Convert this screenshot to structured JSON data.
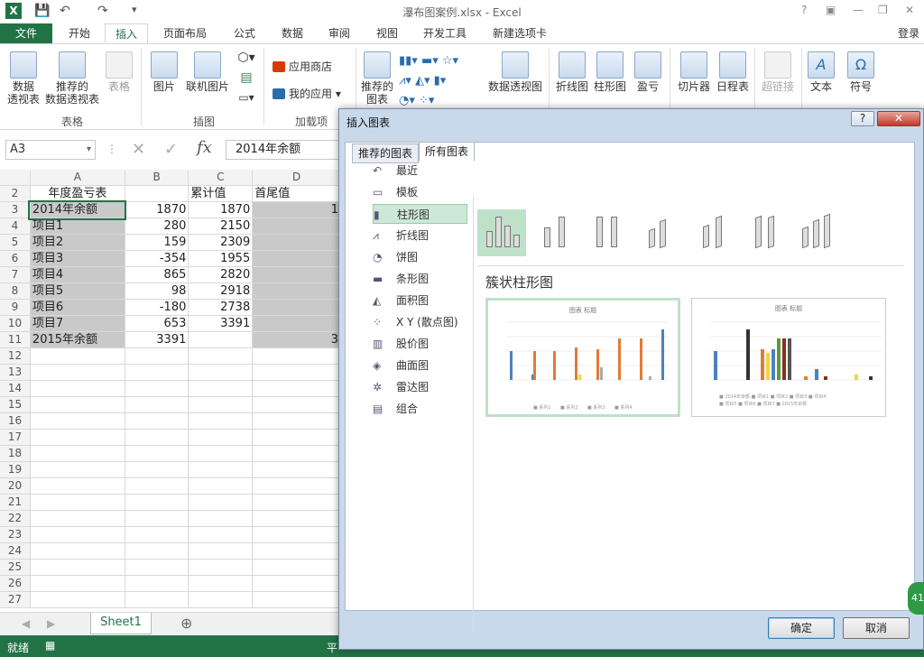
{
  "titlebar": {
    "title": "瀑布图案例.xlsx - Excel",
    "help": "?",
    "login": "登录"
  },
  "tabs": [
    "文件",
    "开始",
    "插入",
    "页面布局",
    "公式",
    "数据",
    "审阅",
    "视图",
    "开发工具",
    "新建选项卡"
  ],
  "ribbon": {
    "pivot": "数据\n透视表",
    "rec_pivot": "推荐的\n数据透视表",
    "table": "表格",
    "group_tables": "表格",
    "picture": "图片",
    "online_picture": "联机图片",
    "group_illus": "插图",
    "app_store": "应用商店",
    "my_apps": "我的应用",
    "group_addins": "加载项",
    "rec_charts": "推荐的\n图表",
    "pivot_chart": "数据透视图",
    "line": "折线图",
    "column": "柱形图",
    "winloss": "盈亏",
    "slicer": "切片器",
    "timeline": "日程表",
    "hyperlink": "超链接",
    "text": "文本",
    "symbol": "符号"
  },
  "formula": {
    "namebox": "A3",
    "content": "2014年余额"
  },
  "grid": {
    "columns": [
      "A",
      "B",
      "C",
      "D"
    ],
    "rows": [
      {
        "n": "2",
        "a": "年度盈亏表",
        "b": "",
        "c": "累计值",
        "d": "首尾值"
      },
      {
        "n": "3",
        "a": "2014年余额",
        "b": "1870",
        "c": "1870",
        "d": "1"
      },
      {
        "n": "4",
        "a": "项目1",
        "b": "280",
        "c": "2150",
        "d": ""
      },
      {
        "n": "5",
        "a": "项目2",
        "b": "159",
        "c": "2309",
        "d": ""
      },
      {
        "n": "6",
        "a": "项目3",
        "b": "-354",
        "c": "1955",
        "d": ""
      },
      {
        "n": "7",
        "a": "项目4",
        "b": "865",
        "c": "2820",
        "d": ""
      },
      {
        "n": "8",
        "a": "项目5",
        "b": "98",
        "c": "2918",
        "d": ""
      },
      {
        "n": "9",
        "a": "项目6",
        "b": "-180",
        "c": "2738",
        "d": ""
      },
      {
        "n": "10",
        "a": "项目7",
        "b": "653",
        "c": "3391",
        "d": ""
      },
      {
        "n": "11",
        "a": "2015年余额",
        "b": "3391",
        "c": "",
        "d": "3"
      },
      {
        "n": "12",
        "a": "",
        "b": "",
        "c": "",
        "d": ""
      },
      {
        "n": "13",
        "a": "",
        "b": "",
        "c": "",
        "d": ""
      },
      {
        "n": "14",
        "a": "",
        "b": "",
        "c": "",
        "d": ""
      },
      {
        "n": "15",
        "a": "",
        "b": "",
        "c": "",
        "d": ""
      },
      {
        "n": "16",
        "a": "",
        "b": "",
        "c": "",
        "d": ""
      },
      {
        "n": "17",
        "a": "",
        "b": "",
        "c": "",
        "d": ""
      },
      {
        "n": "18",
        "a": "",
        "b": "",
        "c": "",
        "d": ""
      },
      {
        "n": "19",
        "a": "",
        "b": "",
        "c": "",
        "d": ""
      },
      {
        "n": "20",
        "a": "",
        "b": "",
        "c": "",
        "d": ""
      },
      {
        "n": "21",
        "a": "",
        "b": "",
        "c": "",
        "d": ""
      },
      {
        "n": "22",
        "a": "",
        "b": "",
        "c": "",
        "d": ""
      },
      {
        "n": "23",
        "a": "",
        "b": "",
        "c": "",
        "d": ""
      },
      {
        "n": "24",
        "a": "",
        "b": "",
        "c": "",
        "d": ""
      },
      {
        "n": "25",
        "a": "",
        "b": "",
        "c": "",
        "d": ""
      },
      {
        "n": "26",
        "a": "",
        "b": "",
        "c": "",
        "d": ""
      },
      {
        "n": "27",
        "a": "",
        "b": "",
        "c": "",
        "d": ""
      }
    ]
  },
  "sheet": {
    "tab": "Sheet1",
    "add": "⊕"
  },
  "status": {
    "ready": "就绪",
    "avg": "平"
  },
  "dialog": {
    "title": "插入图表",
    "tab_recommended": "推荐的图表",
    "tab_all": "所有图表",
    "categories": [
      "最近",
      "模板",
      "柱形图",
      "折线图",
      "饼图",
      "条形图",
      "面积图",
      "X Y (散点图)",
      "股价图",
      "曲面图",
      "雷达图",
      "组合"
    ],
    "selected_title": "簇状柱形图",
    "preview_title": "图表 标题",
    "ok": "确定",
    "cancel": "取消"
  },
  "zoom_badge": "41",
  "colors": {
    "excel_green": "#217346",
    "selected_green": "#bfe0c9"
  }
}
